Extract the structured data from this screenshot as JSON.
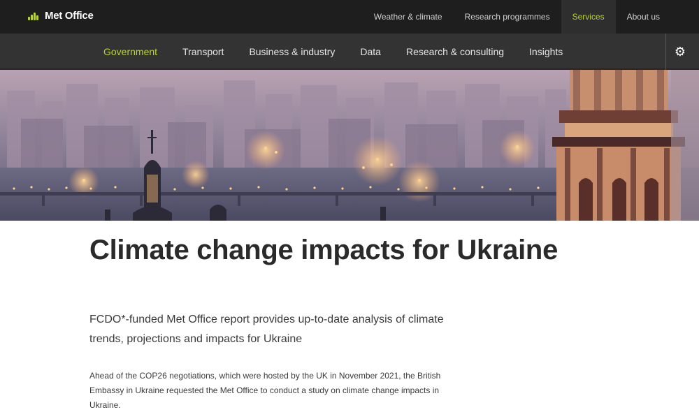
{
  "header": {
    "logo_text": "Met Office",
    "top_links": [
      {
        "label": "Weather & climate"
      },
      {
        "label": "Research programmes"
      },
      {
        "label": "Services"
      },
      {
        "label": "About us"
      }
    ]
  },
  "nav": {
    "items": [
      {
        "label": "Government"
      },
      {
        "label": "Transport"
      },
      {
        "label": "Business & industry"
      },
      {
        "label": "Data"
      },
      {
        "label": "Research & consulting"
      },
      {
        "label": "Insights"
      }
    ],
    "settings_icon": "gear-icon"
  },
  "article": {
    "title": "Climate change impacts for Ukraine",
    "intro": "FCDO*-funded Met Office report provides up-to-date analysis of climate trends, projections and impacts for Ukraine",
    "body": "Ahead of the COP26 negotiations, which were hosted by the UK in November 2021, the British Embassy in Ukraine requested the Met Office to conduct a study on climate change impacts in Ukraine."
  },
  "colors": {
    "accent": "#b7d433",
    "top_bar": "#1e1e1e",
    "nav_bar": "#333333"
  }
}
